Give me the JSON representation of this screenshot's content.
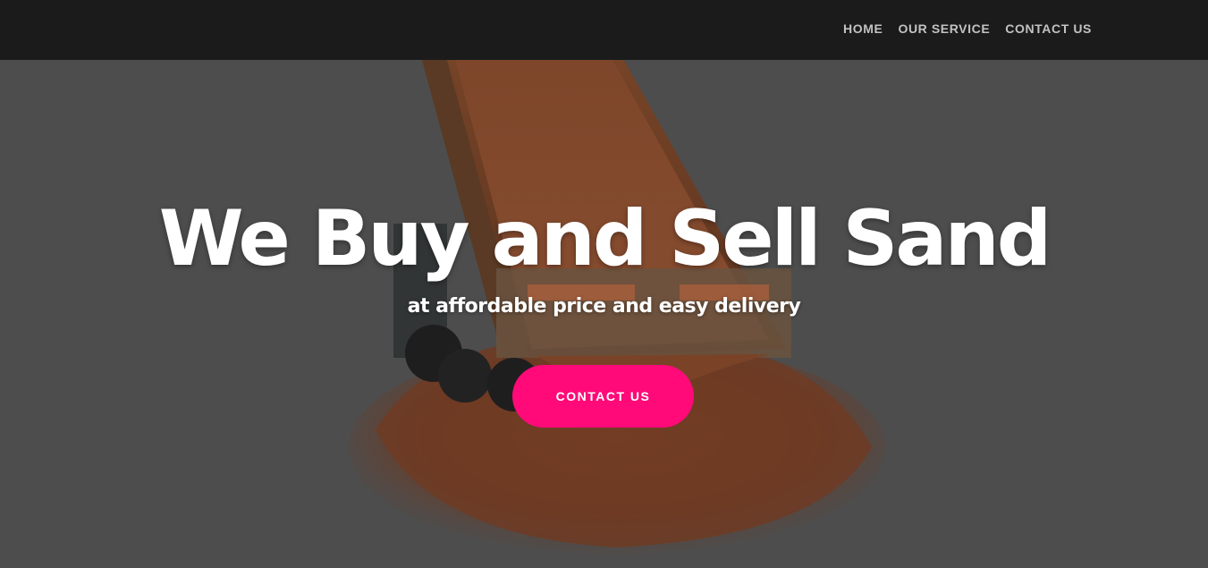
{
  "nav": {
    "items": [
      {
        "label": "HOME"
      },
      {
        "label": "OUR SERVICE"
      },
      {
        "label": "CONTACT US"
      }
    ]
  },
  "hero": {
    "title": "We Buy and Sell Sand",
    "subtitle": "at affordable price and easy delivery",
    "cta_label": "CONTACT US"
  },
  "colors": {
    "navbar_bg": "#1b1b1b",
    "page_bg": "#4d4d4d",
    "accent": "#ff0a78",
    "nav_text": "#c2c2c2"
  }
}
